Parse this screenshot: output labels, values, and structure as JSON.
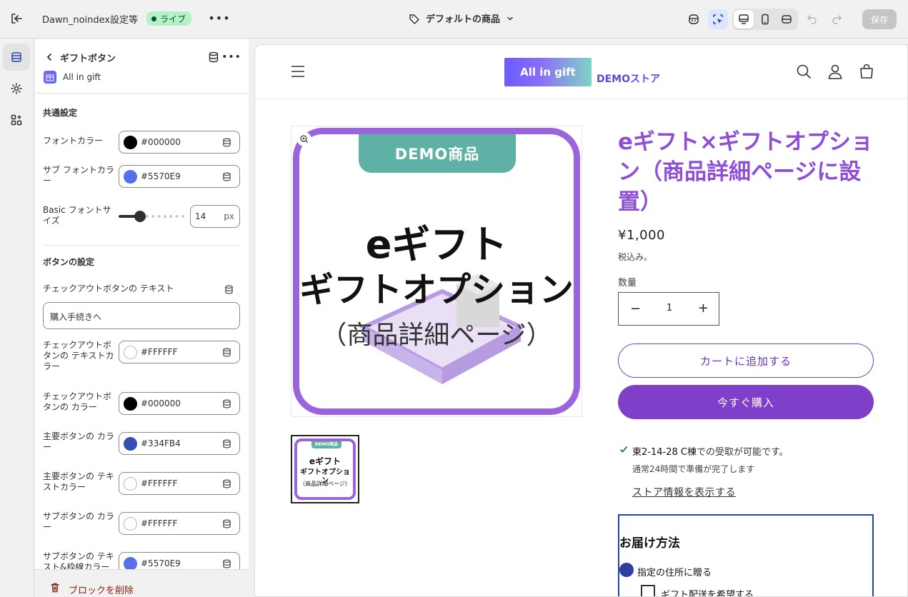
{
  "topbar": {
    "theme_name": "Dawn_noindex設定等",
    "status_badge": "ライブ",
    "more": "•••",
    "template_name": "デフォルトの商品",
    "save_label": "保存"
  },
  "panel": {
    "title": "ギフトボタン",
    "more": "•••",
    "app_name": "All in gift",
    "sections": {
      "common": "共通設定",
      "button": "ボタンの設定"
    },
    "font_color": {
      "label": "フォントカラー",
      "value": "#000000"
    },
    "sub_font_color": {
      "label": "サブ フォントカラー",
      "value": "#5570E9"
    },
    "basic_font_size": {
      "label": "Basic フォントサイズ",
      "value": "14",
      "unit": "px",
      "min": 0,
      "max": 48
    },
    "checkout_text": {
      "label": "チェックアウトボタンの テキスト",
      "value": "購入手続きへ"
    },
    "checkout_text_color": {
      "label": "チェックアウトボタンの テキストカラー",
      "value": "#FFFFFF"
    },
    "checkout_color": {
      "label": "チェックアウトボタンの カラー",
      "value": "#000000"
    },
    "primary_color": {
      "label": "主要ボタンの カラー",
      "value": "#334FB4"
    },
    "primary_text_color": {
      "label": "主要ボタンの テキストカラー",
      "value": "#FFFFFF"
    },
    "sub_color": {
      "label": "サブボタンの カラー",
      "value": "#FFFFFF"
    },
    "sub_text_color": {
      "label": "サブボタンの テキスト&枠線カラー",
      "value": "#5570E9"
    },
    "delete_label": "ブロックを削除"
  },
  "preview": {
    "logo_text": "All in gift",
    "logo_tag": "DEMOストア",
    "image": {
      "badge": "DEMO商品",
      "line1": "eギフト",
      "line2": "ギフトオプション",
      "line3": "（商品詳細ページ）"
    },
    "product_title": "eギフト×ギフトオプション（商品詳細ページに設置）",
    "price": "¥1,000",
    "tax_note": "税込み。",
    "qty_label": "数量",
    "qty_value": "1",
    "qty_minus": "−",
    "qty_plus": "+",
    "add_to_cart": "カートに追加する",
    "buy_now": "今すぐ購入",
    "pickup_location": "東2-14-28 C棟",
    "pickup_text": "での受取が可能です。",
    "pickup_sub": "通常24時間で準備が完了します",
    "store_link": "ストア情報を表示する",
    "delivery_title": "お届け方法",
    "delivery_option": "指定の住所に贈る",
    "gift_shipping": "ギフト配送を希望する"
  },
  "colors": {
    "accent_purple": "#7f3fc9",
    "live_green": "#b4f0c8",
    "delete_red": "#8e1f0b"
  }
}
